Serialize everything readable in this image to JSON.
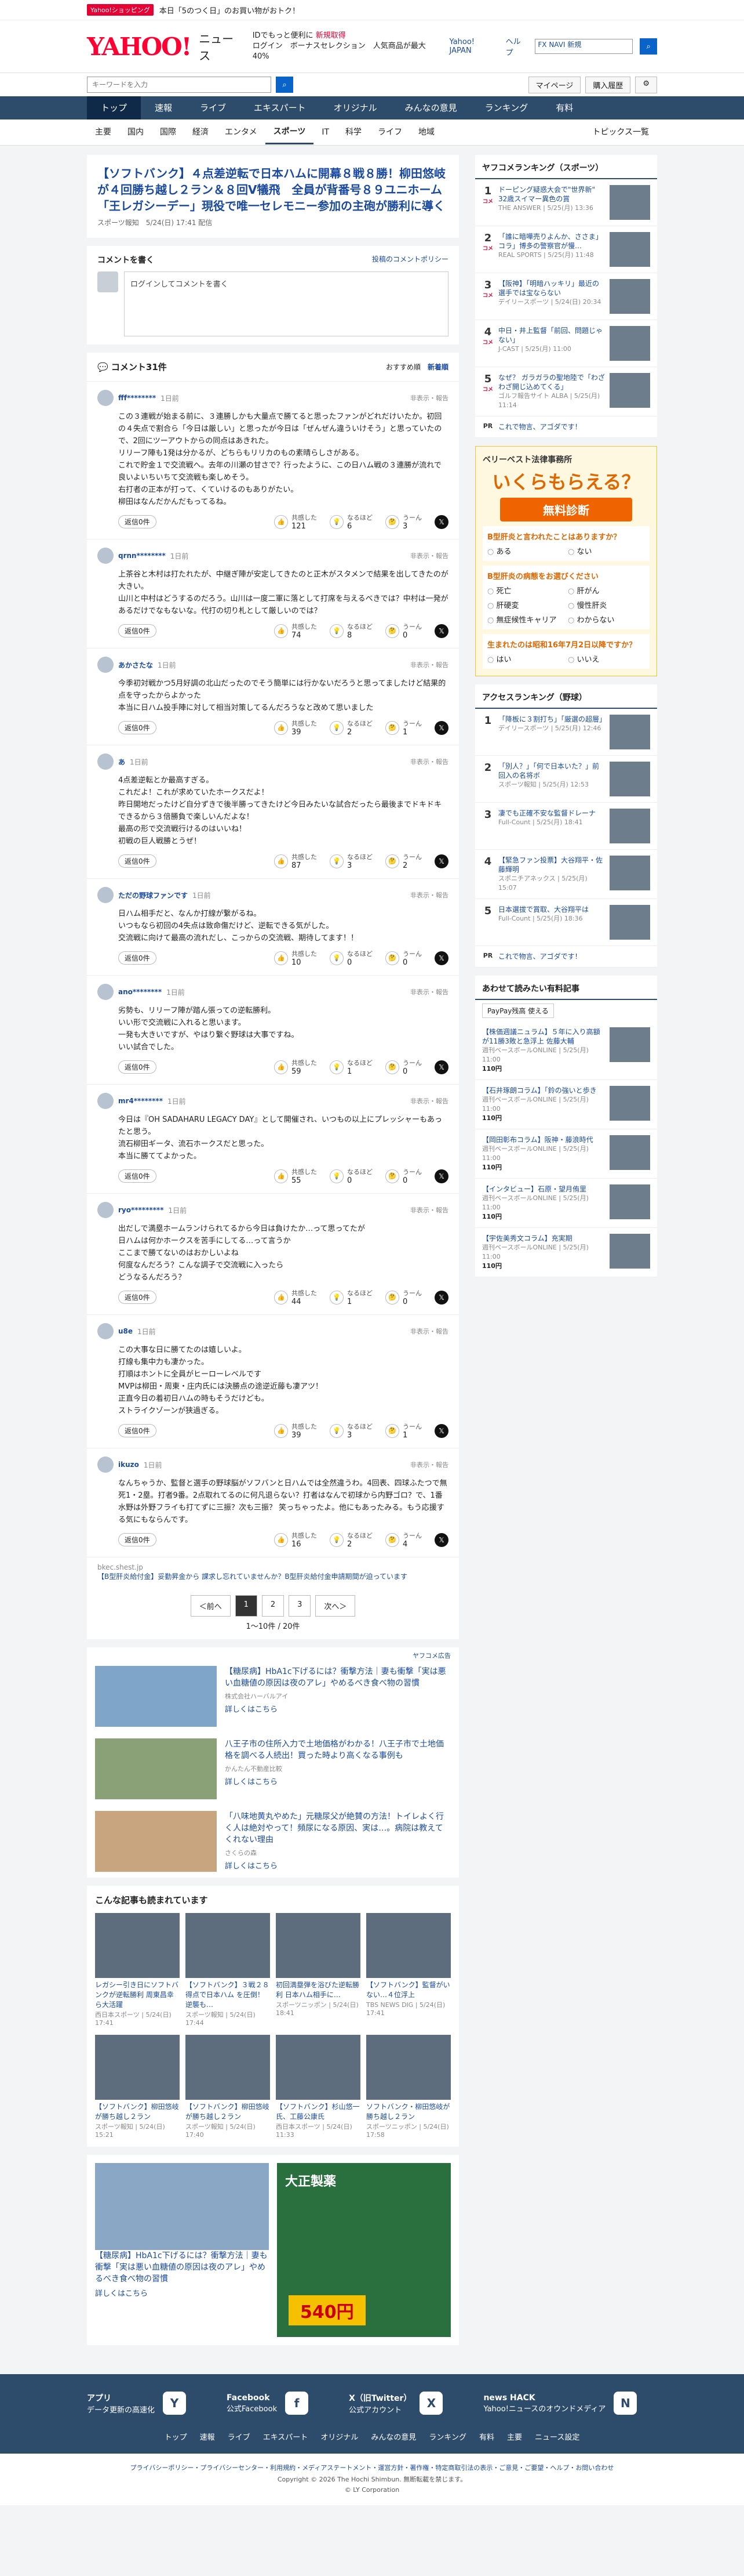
{
  "topstrip": {
    "tag": "Yahoo!ショッピング",
    "text": "本日「5のつく日」のお買い物がおトク！"
  },
  "header": {
    "logo": "YAHOO!",
    "section": "ニュース",
    "promo_line1": "IDでもっと便利に",
    "promo_link": "新規取得",
    "promo_line2": "ログイン",
    "promo_line3": "ボーナスセレクション　人気商品が最大40%",
    "util": [
      "Yahoo! JAPAN",
      "ヘルプ"
    ],
    "search_value": "FX NAVI 新規"
  },
  "searchbar": {
    "placeholder": "キーワードを入力",
    "mypage": "マイページ",
    "purchase": "購入履歴"
  },
  "nav": [
    "トップ",
    "速報",
    "ライブ",
    "エキスパート",
    "オリジナル",
    "みんなの意見",
    "ランキング",
    "有料"
  ],
  "subnav": [
    "主要",
    "国内",
    "国際",
    "経済",
    "エンタメ",
    "スポーツ",
    "IT",
    "科学",
    "ライフ",
    "地域"
  ],
  "subnav_topics": "トピックス一覧",
  "article": {
    "title": "【ソフトバンク】４点差逆転で日本ハムに開幕８戦８勝！柳田悠岐が４回勝ち越し２ラン＆８回V犠飛　全員が背番号８９ユニホーム「王レガシーデー」現役で唯一セレモニー参加の主砲が勝利に導く",
    "meta": "スポーツ報知　5/24(日) 17:41 配信"
  },
  "comment_box": {
    "title": "コメントを書く",
    "policy": "投稿のコメントポリシー",
    "placeholder": "ログインしてコメントを書く"
  },
  "comments_head": {
    "title": "コメント31件",
    "sort_a": "おすすめ順",
    "sort_b": "新着順"
  },
  "labels": {
    "reply": "返信0件",
    "agree": "共感した",
    "think": "なるほど",
    "hmm": "うーん",
    "report": "非表示・報告"
  },
  "comments": [
    {
      "name": "fff********",
      "time": "1日前",
      "text": "この３連戦が始まる前に、３連勝しかも大量点で勝てると思ったファンがどれだけいたか。初回の４失点で割合ら「今日は厳しい」と思ったが今日は「ぜんぜん違ういけそう」と思っていたので、2回にツーアウトからの同点はあきれた。\nリリーフ陣も1発は分かるが、どちらもリリカのもの素晴らしさがある。\nこれで貯金１で交流戦へ。去年の川瀬の甘さで？行ったように、この日ハム戦の３連勝が流れで良いよいちいちて交流戦も楽しめそう。\n右打者の正本が打って、くていけるのもありがたい。\n柳田はなんだかんだもってるね。",
      "agree": 121,
      "think": 6,
      "hmm": 3
    },
    {
      "name": "qrnn********",
      "time": "1日前",
      "text": "上茶谷と木村は打たれたが、中継ぎ陣が安定してきたのと正木がスタメンで結果を出してきたのが大きい。\n山川と中村はどうするのだろう。山川は一度二軍に落として打席を与えるべきでは？中村は一発があるだけでなもないな。代打の切り札として厳しいのでは？",
      "agree": 74,
      "think": 8,
      "hmm": 0
    },
    {
      "name": "あかさたな",
      "time": "1日前",
      "text": "今季初対戦かつ5月好調の北山だったのでそう簡単には行かないだろうと思ってましたけど結果的点を守ったからよかった\n本当に日ハム投手陣に対して相当対策してるんだろうなと改めて思いました",
      "agree": 39,
      "think": 2,
      "hmm": 1
    },
    {
      "name": "あ",
      "time": "1日前",
      "text": "4点差逆転とか最高すぎる。\nこれだよ！これが求めていたホークスだよ！\n昨日開地だったけど自分ずきで後半勝ってきたけど今日みたいな試合だったら最後までドキドキできるから３倍勝負で楽しいんだよな！\n最高の形で交流戦行けるのはいいね！\n初戦の巨人戦勝とうぜ！",
      "agree": 87,
      "think": 3,
      "hmm": 2
    },
    {
      "name": "ただの野球ファンです",
      "time": "1日前",
      "text": "日ハム相手だと、なんか打線が繋がるね。\nいつもなら初回の4失点は致命傷だけど、逆転できる気がした。\n交流戦に向けて最高の流れだし、こっからの交流戦、期待してます！！",
      "agree": 10,
      "think": 0,
      "hmm": 0
    },
    {
      "name": "ano********",
      "time": "1日前",
      "text": "劣勢も、リリーフ陣が踏ん張っての逆転勝利。\nいい形で交流戦に入れると思います。\n一発も大きいですが、やはり繋ぐ野球は大事ですね。\nいい試合でした。",
      "agree": 59,
      "think": 1,
      "hmm": 0
    },
    {
      "name": "mr4********",
      "time": "1日前",
      "text": "今日は『OH SADAHARU LEGACY DAY』として開催され、いつもの以上にプレッシャーもあったと思う。\n流石柳田ギータ、流石ホークスだと思った。\n本当に勝ててよかった。",
      "agree": 55,
      "think": 0,
      "hmm": 0
    },
    {
      "name": "ryo*********",
      "time": "1日前",
      "text": "出だしで満塁ホームランけられてるから今日は負けたか…って思ってたが\n日ハムは何かホークスを苦手にしてる…って言うか\nここまで勝てないのはおかしいよね\n何度なんだろう？こんな調子で交流戦に入ったら\nどうなるんだろう？",
      "agree": 44,
      "think": 1,
      "hmm": 0
    },
    {
      "name": "u8e",
      "time": "1日前",
      "text": "この大事な日に勝てたのは嬉しいよ。\n打線も集中力も凄かった。\n打順はホントに全員がヒーローレベルです\nMVPは柳田・周東・庄内氏には決勝点の途逆近藤も凄アツ！\n正直今日の着初日ハムの時もそうだけども。\nストライクゾーンが狭過ぎる。",
      "agree": 39,
      "think": 3,
      "hmm": 1
    },
    {
      "name": "ikuzo",
      "time": "1日前",
      "text": "なんちゃうか、監督と選手の野球脳がソフバンと日ハムでは全然違うわ。4回表、四球ふたつで無死1・2塁。打者9番。2点取れてるのに何凡退らない？打者はなんで初球から内野ゴロ？で、1番水野は外野フライも打てずに三振？次も三振？ 笑っちゃったよ。他にもあったみる。もう応援する気にもならんです。",
      "agree": 16,
      "think": 2,
      "hmm": 4
    }
  ],
  "ad_line": {
    "source": "bkec.shest.jp",
    "text": "【B型肝炎給付金】妥勤昇金から 課求し忘れていませんか？B型肝炎給付金申請期間が迫っています",
    "tag": "広告"
  },
  "pager": {
    "prev": "＜前へ",
    "pages": [
      "1",
      "2",
      "3"
    ],
    "next": "次へ＞",
    "count": "1〜10件 / 20件"
  },
  "ads_label": "ヤフコメ広告",
  "ads": [
    {
      "title": "【糖尿病】HbA1c下げるには？衝撃方法｜妻も衝撃「実は悪い血糖値の原因は夜のアレ」やめるべき食べ物の習慣",
      "sponsor": "株式会社ハーバルアイ",
      "link": "詳しくはこちら"
    },
    {
      "title": "八王子市の住所入力で土地価格がわかる！八王子市で土地価格を調べる人続出！買った時より高くなる事例も",
      "sponsor": "かんたん不動産比較",
      "link": "詳しくはこちら"
    },
    {
      "title": "「八味地黄丸やめた」元糖尿父が絶賛の方法！トイレよく行く人は絶対やって！頻尿になる原因、実は…。病院は教えてくれない理由",
      "sponsor": "さくらの森",
      "link": "詳しくはこちら"
    }
  ],
  "grid_head": "こんな記事も読まれています",
  "grid": [
    {
      "text": "レガシー引き日にソフトバンクが逆転勝利 周東昌幸ら大活躍",
      "src": "西日本スポーツ | 5/24(日) 17:41"
    },
    {
      "text": "【ソフトバンク】３戦２８得点で日本ハム を圧倒！逆襲も…",
      "src": "スポーツ報知 | 5/24(日) 17:44"
    },
    {
      "text": "初回満塁弾を浴びた逆転勝利 日本ハム相手に…",
      "src": "スポーツニッポン | 5/24(日) 18:41"
    },
    {
      "text": "【ソフトバンク】監督がいない…４位浮上",
      "src": "TBS NEWS DIG | 5/24(日) 17:41"
    },
    {
      "text": "【ソフトバンク】柳田悠岐が勝ち越し２ラン",
      "src": "スポーツ報知 | 5/24(日) 15:21"
    },
    {
      "text": "【ソフトバンク】柳田悠岐が勝ち越し２ラン",
      "src": "スポーツ報知 | 5/24(日) 17:40"
    },
    {
      "text": "【ソフトバンク】杉山悠一氏、工藤公康氏",
      "src": "西日本スポーツ | 5/24(日) 11:33"
    },
    {
      "text": "ソフトバンク・柳田悠岐が勝ち越し２ラン",
      "src": "スポーツニッポン | 5/24(日) 17:58"
    }
  ],
  "bottom_ads": [
    {
      "title": "【糖尿病】HbA1c下げるには？衝撃方法｜妻も衝撃「実は悪い血糖値の原因は夜のアレ」やめるべき食べ物の習慣",
      "link": "詳しくはこちら"
    },
    {
      "title": "大正製薬",
      "price": "540円"
    }
  ],
  "side_rank1": {
    "title": "ヤフコメランキング（スポーツ）",
    "items": [
      {
        "badge": "コメ",
        "text": "ドーピング疑惑大会で\"世界新\" 32歳スイマー異色の賞",
        "src": "THE ANSWER | 5/25(月) 13:36"
      },
      {
        "badge": "コメ",
        "text": "「誰に暗嘩売りよんか、ささま」コラ」博多の警察官が慢…",
        "src": "REAL SPORTS | 5/25(月) 11:48"
      },
      {
        "badge": "コメ",
        "text": "【阪神】「明暗ハッキリ」最近の選手では宝ならない",
        "src": "デイリースポーツ | 5/24(日) 20:34"
      },
      {
        "badge": "コメ",
        "text": "中日・井上監督「前回、問題じゃない」",
        "src": "J-CAST | 5/25(月) 11:00"
      },
      {
        "badge": "コメ",
        "text": "なぜ？ ガラガラの聖地陸で「わざわざ開じ込めてくる」",
        "src": "ゴルフ報告サイト ALBA | 5/25(月) 11:14"
      }
    ],
    "pr": "これで物言、アゴダです！"
  },
  "law_ad": {
    "firm": "ベリーベスト法律事務所",
    "big": "いくらもらえる？",
    "diag": "無料診断",
    "q1": "B型肝炎と言われたことはありますか？",
    "q1_opts": [
      "ある",
      "ない"
    ],
    "q2": "B型肝炎の病態をお選びください",
    "q2_opts": [
      "死亡",
      "肝がん",
      "肝硬変",
      "慢性肝炎",
      "無症候性キャリア",
      "わからない"
    ],
    "q3": "生まれたのは昭和16年7月2日以降ですか？",
    "q3_opts": [
      "はい",
      "いいえ"
    ]
  },
  "side_rank2": {
    "title": "アクセスランキング（野球）",
    "items": [
      {
        "text": "「降板に３割打ち」「厳選の超層」",
        "src": "デイリースポーツ | 5/25(月) 12:46"
      },
      {
        "text": "「別人？」「何で日本いた？」前回入の名将ボ",
        "src": "スポーツ報知 | 5/25(月) 12:53"
      },
      {
        "text": "凄でも正確不安な監督ドレーナ",
        "src": "Full-Count | 5/25(月) 18:41"
      },
      {
        "text": "【緊急ファン投票】大谷翔平・佐藤輝明",
        "src": "スポニチアネックス | 5/25(月) 15:07"
      },
      {
        "text": "日本選拔で賞取、大谷翔平は",
        "src": "Full-Count | 5/25(月) 18:36"
      }
    ],
    "pr": "これで物言、アゴダです！"
  },
  "paid_rank": {
    "title": "あわせて読みたい有料記事",
    "paypay": "PayPay残高 使える",
    "items": [
      {
        "text": "【株価週議ニュラム】５年に入り高額が11勝3敗と急浮上 佐藤大輔",
        "src": "週刊ベースボールONLINE | 5/25(月) 11:00",
        "price": "110円"
      },
      {
        "text": "【石井琢朗コラム】「鈴の強いと歩き",
        "src": "週刊ベースボールONLINE | 5/25(月) 11:00",
        "price": "110円"
      },
      {
        "text": "【岡田彰布コラム】阪神・藤浪時代",
        "src": "週刊ベースボールONLINE | 5/25(月) 11:00",
        "price": "110円"
      },
      {
        "text": "【インタビュー】石原・望月侑里",
        "src": "週刊ベースボールONLINE | 5/25(月) 11:00",
        "price": "110円"
      },
      {
        "text": "【宇佐美秀文コラム】充実期",
        "src": "週刊ベースボールONLINE | 5/25(月) 11:00",
        "price": "110円"
      }
    ]
  },
  "footer": {
    "apps": [
      {
        "name": "アプリ",
        "desc": "データ更新の高速化",
        "icon": "Y"
      },
      {
        "name": "Facebook",
        "desc": "公式Facebook",
        "icon": "f"
      },
      {
        "name": "X（旧Twitter）",
        "desc": "公式アカウント",
        "icon": "X"
      },
      {
        "name": "news HACK",
        "desc": "Yahoo!ニュースのオウンドメディア",
        "icon": "N"
      }
    ],
    "links": [
      "トップ",
      "速報",
      "ライブ",
      "エキスパート",
      "オリジナル",
      "みんなの意見",
      "ランキング",
      "有料",
      "主要",
      "ニュース設定"
    ],
    "policy": "プライバシーポリシー・プライバシーセンター・利用規約・メディアステートメント・運営方針・著作権・特定商取引法の表示・ご意見・ご要望・ヘルプ・お問い合わせ",
    "copyright1": "Copyright © 2026 The Hochi Shimbun. 無断転載を禁じます。",
    "copyright2": "© LY Corporation"
  }
}
